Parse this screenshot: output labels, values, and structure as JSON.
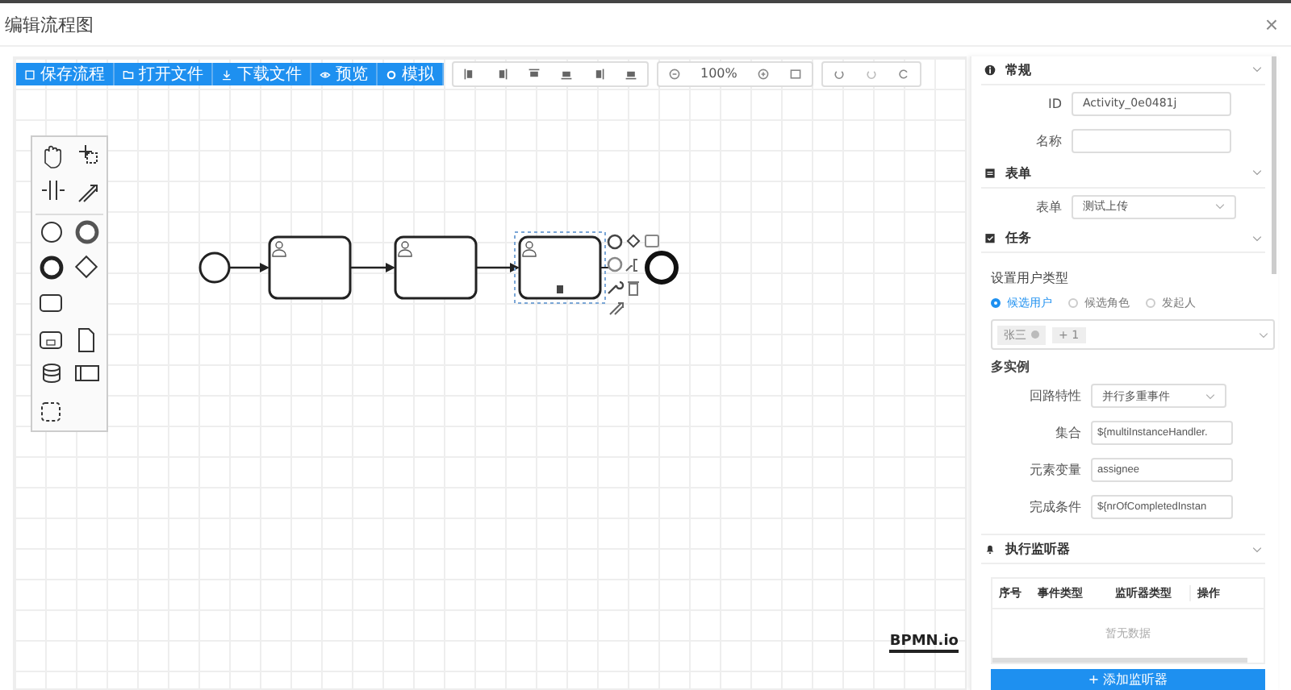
{
  "window": {
    "title": "编辑流程图",
    "close": "×"
  },
  "toolbar": {
    "actions": [
      {
        "label": "保存流程"
      },
      {
        "label": "打开文件"
      },
      {
        "label": "下载文件"
      },
      {
        "label": "预览"
      },
      {
        "label": "模拟"
      }
    ],
    "zoom": "100%"
  },
  "logo": "BPMN.io",
  "panel": {
    "general": {
      "title": "常规",
      "fields": [
        {
          "label": "ID",
          "value": "Activity_0e0481j"
        },
        {
          "label": "名称"
        }
      ]
    },
    "form": {
      "title": "表单",
      "label": "表单",
      "value": "测试上传"
    },
    "task": {
      "title": "任务",
      "user_type_label": "设置用户类型",
      "radios": [
        {
          "label": "候选用户",
          "selected": true
        },
        {
          "label": "候选角色",
          "selected": false
        },
        {
          "label": "发起人",
          "selected": false
        }
      ],
      "tags": [
        "张三",
        "+ 1"
      ],
      "multi_title": "多实例",
      "fields": [
        {
          "label": "回路特性",
          "value": "并行多重事件",
          "kind": "select"
        },
        {
          "label": "集合",
          "value": "${multiInstanceHandler.",
          "kind": "input"
        },
        {
          "label": "元素变量",
          "value": "assignee",
          "kind": "input"
        },
        {
          "label": "完成条件",
          "value": "${nrOfCompletedInstan",
          "kind": "input"
        }
      ]
    },
    "listeners": {
      "title": "执行监听器",
      "columns": [
        "序号",
        "事件类型",
        "监听器类型",
        "操作"
      ],
      "empty": "暂无数据",
      "add": "+ 添加监听器"
    }
  }
}
